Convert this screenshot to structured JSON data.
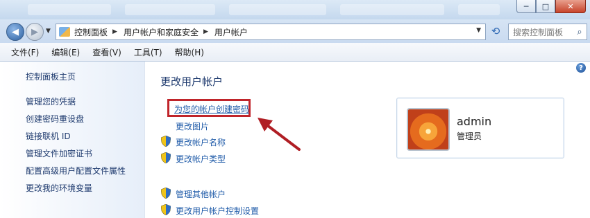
{
  "window": {
    "minimize": "─",
    "maximize": "□",
    "close": "✕"
  },
  "navbar": {
    "back_glyph": "◀",
    "forward_glyph": "▶",
    "breadcrumbs": [
      "控制面板",
      "用户帐户和家庭安全",
      "用户帐户"
    ],
    "search_placeholder": "搜索控制面板",
    "icons": {
      "back": "back-arrow-icon",
      "forward": "forward-arrow-icon",
      "refresh": "refresh-icon",
      "search": "search-icon"
    }
  },
  "menu": {
    "file": "文件(F)",
    "edit": "编辑(E)",
    "view": "查看(V)",
    "tools": "工具(T)",
    "help": "帮助(H)"
  },
  "sidebar": {
    "home": "控制面板主页",
    "links": [
      "管理您的凭据",
      "创建密码重设盘",
      "链接联机 ID",
      "管理文件加密证书",
      "配置高级用户配置文件属性",
      "更改我的环境变量"
    ]
  },
  "main": {
    "title": "更改用户帐户",
    "tasks": {
      "create_password": "为您的帐户创建密码",
      "change_picture": "更改图片",
      "change_name": "更改帐户名称",
      "change_type": "更改帐户类型",
      "manage_other": "管理其他帐户",
      "uac_settings": "更改用户帐户控制设置"
    },
    "help_glyph": "?"
  },
  "user": {
    "name": "admin",
    "role": "管理员"
  },
  "colors": {
    "highlight_box": "#c0242a",
    "arrow": "#b01e24",
    "link": "#1e5aa8",
    "title": "#1e3a6e"
  }
}
